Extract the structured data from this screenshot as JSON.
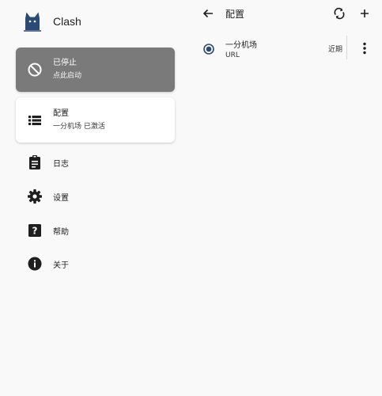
{
  "brand": {
    "title": "Clash",
    "logo_icon": "cat-icon",
    "logo_color": "#2b4a75"
  },
  "status_card": {
    "title": "已停止",
    "subtitle": "点此启动",
    "icon": "block-icon",
    "background": "#7a7a7a"
  },
  "config_card": {
    "title": "配置",
    "subtitle": "一分机场 已激活",
    "icon": "list-icon"
  },
  "nav": {
    "items": [
      {
        "label": "日志",
        "icon": "clipboard-icon"
      },
      {
        "label": "设置",
        "icon": "gear-icon"
      },
      {
        "label": "帮助",
        "icon": "help-icon"
      },
      {
        "label": "关于",
        "icon": "info-icon"
      }
    ]
  },
  "appbar": {
    "title": "配置",
    "back_icon": "arrow-back-icon",
    "refresh_icon": "sync-icon",
    "add_icon": "plus-icon"
  },
  "profiles": [
    {
      "name": "一分机场",
      "type": "URL",
      "updated": "近期",
      "selected": true
    }
  ],
  "colors": {
    "accent": "#2b4a75",
    "icon": "#1e1e1e",
    "background": "#f9f9f9"
  }
}
